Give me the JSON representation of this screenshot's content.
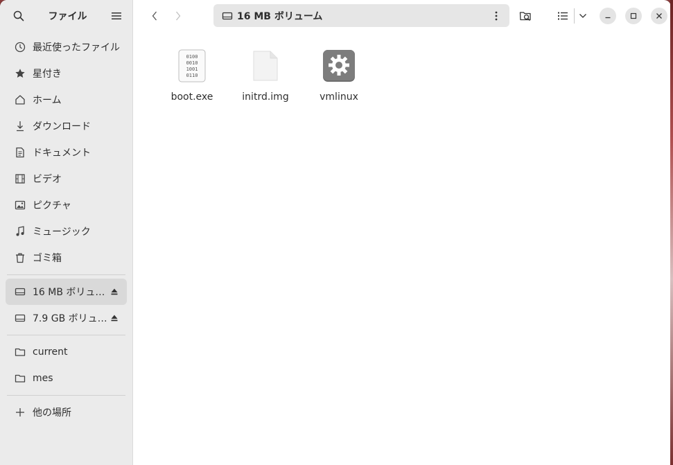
{
  "sidebar": {
    "title": "ファイル",
    "places": [
      {
        "label": "最近使ったファイル",
        "icon": "clock-icon"
      },
      {
        "label": "星付き",
        "icon": "star-icon"
      },
      {
        "label": "ホーム",
        "icon": "home-icon"
      },
      {
        "label": "ダウンロード",
        "icon": "download-icon"
      },
      {
        "label": "ドキュメント",
        "icon": "document-icon"
      },
      {
        "label": "ビデオ",
        "icon": "film-icon"
      },
      {
        "label": "ピクチャ",
        "icon": "picture-icon"
      },
      {
        "label": "ミュージック",
        "icon": "music-icon"
      },
      {
        "label": "ゴミ箱",
        "icon": "trash-icon"
      }
    ],
    "devices": [
      {
        "label": "16 MB ボリュ…",
        "icon": "drive-icon",
        "active": true
      },
      {
        "label": "7.9 GB ボリュ…",
        "icon": "drive-icon",
        "active": false
      }
    ],
    "bookmarks": [
      {
        "label": "current",
        "icon": "folder-icon"
      },
      {
        "label": "mes",
        "icon": "folder-icon"
      }
    ],
    "other_locations": "他の場所"
  },
  "pathbar": {
    "label": "16 MB ボリューム"
  },
  "files": [
    {
      "name": "boot.exe",
      "icon": "binary-file-icon"
    },
    {
      "name": "initrd.img",
      "icon": "generic-file-icon"
    },
    {
      "name": "vmlinux",
      "icon": "executable-gear-icon"
    }
  ],
  "colors": {
    "sidebar_bg": "#ebebeb",
    "active_item": "#d9d9d9",
    "pathbar_bg": "#e6e6e6"
  }
}
